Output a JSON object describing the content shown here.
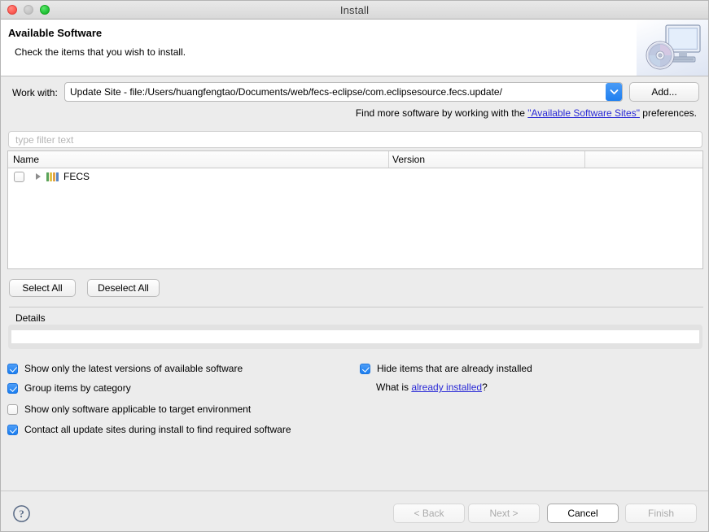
{
  "window": {
    "title": "Install",
    "traffic_lights": [
      "close-button",
      "minimize-button",
      "zoom-button"
    ]
  },
  "header": {
    "title": "Available Software",
    "subtitle": "Check the items that you wish to install.",
    "artwork": "computer-cd-icon"
  },
  "workwith": {
    "label": "Work with:",
    "value": "Update Site - file:/Users/huangfengtao/Documents/web/fecs-eclipse/com.eclipsesource.fecs.update/",
    "dropdown_icon": "chevron-down-icon",
    "add_label": "Add...",
    "hint_prefix": "Find more software by working with the ",
    "hint_link": "\"Available Software Sites\"",
    "hint_suffix": " preferences."
  },
  "filter": {
    "placeholder": "type filter text",
    "value": ""
  },
  "tree": {
    "columns": [
      "Name",
      "Version"
    ],
    "rows": [
      {
        "name": "FECS",
        "version": "",
        "checked": false,
        "expanded": false,
        "icon": "feature-category-icon",
        "icon_colors": [
          "#4f9e4f",
          "#d8b13a",
          "#d89b3a",
          "#4f7fbf"
        ]
      }
    ]
  },
  "tree_buttons": {
    "select_all": "Select All",
    "deselect_all": "Deselect All"
  },
  "details": {
    "label": "Details",
    "text": ""
  },
  "options": {
    "show_latest": {
      "label": "Show only the latest versions of available software",
      "checked": true
    },
    "group_by_category": {
      "label": "Group items by category",
      "checked": true
    },
    "applicable_target": {
      "label": "Show only software applicable to target environment",
      "checked": false
    },
    "contact_all_sites": {
      "label": "Contact all update sites during install to find required software",
      "checked": true
    },
    "hide_installed": {
      "label": "Hide items that are already installed",
      "checked": true
    },
    "what_is_prefix": "What is ",
    "what_is_link": "already installed",
    "what_is_suffix": "?"
  },
  "footer": {
    "help_icon": "help-icon",
    "back": "< Back",
    "next": "Next >",
    "cancel": "Cancel",
    "finish": "Finish",
    "back_enabled": false,
    "next_enabled": false,
    "cancel_enabled": true,
    "finish_enabled": false
  },
  "colors": {
    "accent_blue": "#1a7ef0",
    "link_blue": "#2a2ad6",
    "window_bg": "#ececec",
    "panel_white": "#ffffff"
  }
}
